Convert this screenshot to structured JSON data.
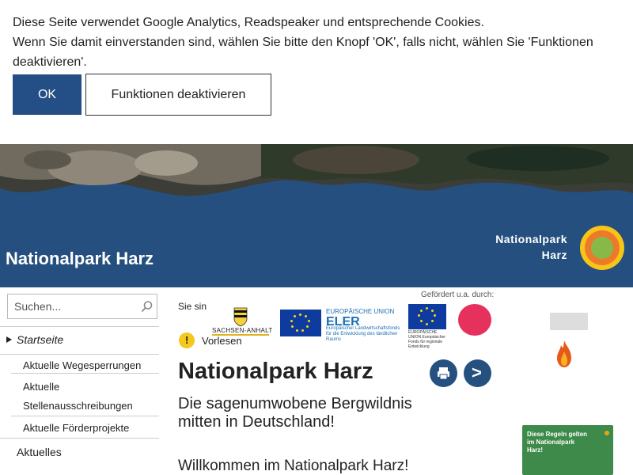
{
  "cookie_banner": {
    "line1": "Diese Seite verwendet Google Analytics, Readspeaker und entsprechende Cookies.",
    "line2": "Wenn Sie damit einverstanden sind, wählen Sie bitte den Knopf 'OK', falls nicht, wählen Sie 'Funktionen deaktivieren'.",
    "ok_label": "OK",
    "deactivate_label": "Funktionen deaktivieren"
  },
  "header": {
    "site_title": "Nationalpark Harz",
    "logo_line1": "Nationalpark",
    "logo_line2": "Harz",
    "colors": {
      "band": "#254f7e",
      "logo_outer": "#f7c418",
      "logo_ring": "#ec7a2a",
      "logo_core": "#88b948"
    }
  },
  "sidebar": {
    "search_placeholder": "Suchen...",
    "items": [
      {
        "label": "Startseite",
        "active": true
      },
      {
        "label": "Aktuelle Wegesperrungen"
      },
      {
        "label": "Aktuelle"
      },
      {
        "label": "Stellenausschreibungen"
      },
      {
        "label": "Aktuelle Förderprojekte"
      },
      {
        "label": "Aktuelles"
      }
    ]
  },
  "main": {
    "breadcrumb": "Sie sin",
    "vorlesen_label": "Vorlesen",
    "funding_label": "Gefördert u.a. durch:",
    "funding_logos": {
      "sachsen_anhalt": "SACHSEN-ANHALT",
      "eler_small": "EUROPÄISCHE UNION",
      "eler_big": "ELER",
      "eler_sub": "Europäischer Landwirtschaftsfonds für die Entwicklung des ländlichen Raums",
      "efre_text": "EUROPÄISCHE UNION Europäischer Fonds für regionale Entwicklung"
    },
    "title": "Nationalpark Harz",
    "subtitle": "Die sagenumwobene Bergwildnis mitten in Deutschland!",
    "welcome": "Willkommen im Nationalpark Harz!"
  },
  "right_column": {
    "promo_text": "Diese Regeln gelten im Nationalpark Harz!"
  }
}
